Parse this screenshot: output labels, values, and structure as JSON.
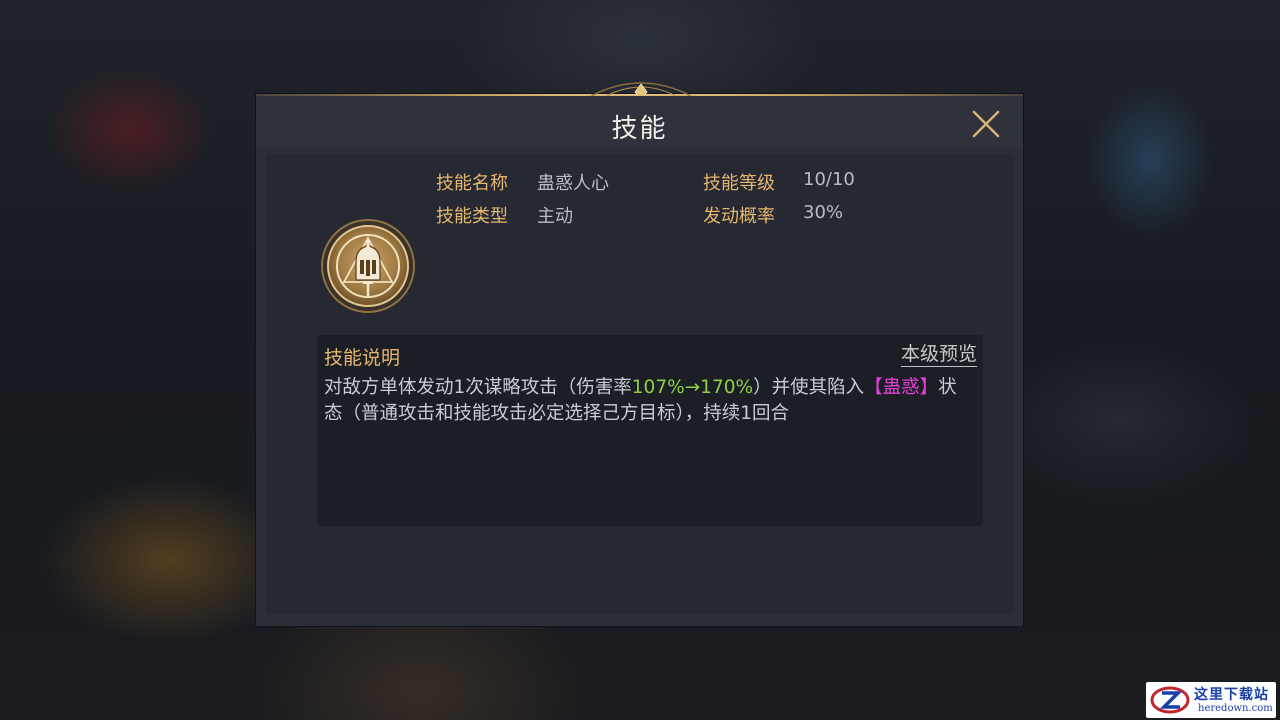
{
  "dialog": {
    "title": "技能",
    "close_icon": "close-x-icon"
  },
  "skill": {
    "icon": "knight-helmet-sword-icon",
    "name_label": "技能名称",
    "name_value": "蛊惑人心",
    "type_label": "技能类型",
    "type_value": "主动",
    "level_label": "技能等级",
    "level_value": "10/10",
    "chance_label": "发动概率",
    "chance_value": "30%"
  },
  "description": {
    "title": "技能说明",
    "preview_link": "本级预览",
    "part1": "对敌方单体发动1次谋略攻击（伤害率",
    "damage_rate": "107%→170%",
    "part2": "）并使其陷入",
    "status_name": "【蛊惑】",
    "part3": "状态（普通攻击和技能攻击必定选择己方目标），持续1回合"
  },
  "watermark": {
    "title": "这里下载站",
    "url": "heredown.com"
  },
  "colors": {
    "gold_label": "#e4b66e",
    "value_text": "#b9bcc4",
    "highlight_green": "#8fce45",
    "highlight_magenta": "#e33fd6"
  }
}
